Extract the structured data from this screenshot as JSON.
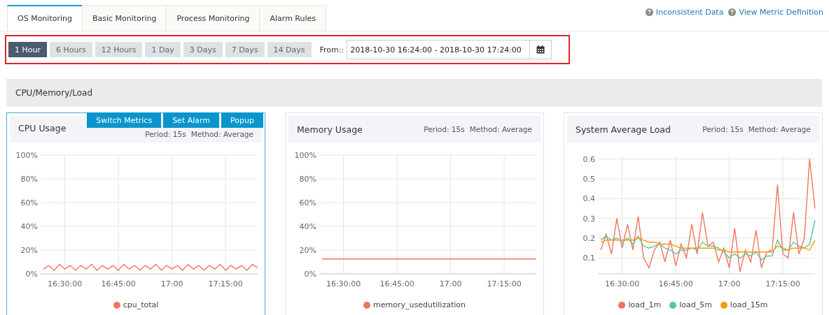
{
  "tabs": [
    {
      "label": "OS Monitoring",
      "selected": true
    },
    {
      "label": "Basic Monitoring",
      "selected": false
    },
    {
      "label": "Process Monitoring",
      "selected": false
    },
    {
      "label": "Alarm Rules",
      "selected": false
    }
  ],
  "help_links": [
    {
      "label": "Inconsistent Data"
    },
    {
      "label": "View Metric Definition"
    }
  ],
  "time_ranges": [
    {
      "label": "1 Hour",
      "selected": true
    },
    {
      "label": "6 Hours",
      "selected": false
    },
    {
      "label": "12 Hours",
      "selected": false
    },
    {
      "label": "1 Day",
      "selected": false
    },
    {
      "label": "3 Days",
      "selected": false
    },
    {
      "label": "7 Days",
      "selected": false
    },
    {
      "label": "14 Days",
      "selected": false
    }
  ],
  "date_range": {
    "label": "From::",
    "value": "2018-10-30 16:24:00 - 2018-10-30 17:24:00"
  },
  "section": {
    "title": "CPU/Memory/Load"
  },
  "cards": [
    {
      "title": "CPU Usage",
      "period": "Period: 15s",
      "method": "Method: Average",
      "selected": true,
      "actions": [
        "Switch Metrics",
        "Set Alarm",
        "Popup"
      ],
      "chart_data": {
        "type": "line",
        "grid": true,
        "legend": "bottom",
        "categories": [
          null,
          null,
          null,
          null,
          "16:30:00",
          null,
          null,
          null,
          null,
          null,
          null,
          null,
          null,
          null,
          "16:45:00",
          null,
          null,
          null,
          null,
          null,
          null,
          null,
          null,
          null,
          "17:00",
          null,
          null,
          null,
          null,
          null,
          null,
          null,
          null,
          null,
          "17:15:00",
          null,
          null,
          null,
          null,
          null,
          null
        ],
        "ylim": [
          0,
          100
        ],
        "yticks": [
          {
            "value": 0,
            "label": "0%"
          },
          {
            "value": 20,
            "label": "20%"
          },
          {
            "value": 40,
            "label": "40%"
          },
          {
            "value": 60,
            "label": "60%"
          },
          {
            "value": 80,
            "label": "80%"
          },
          {
            "value": 100,
            "label": "100%"
          }
        ],
        "series": [
          {
            "name": "cpu_total",
            "color": "#f4735f",
            "values": [
              4,
              7,
              3,
              8,
              4,
              7,
              3,
              7,
              4,
              8,
              3,
              7,
              4,
              7,
              3,
              8,
              4,
              7,
              3,
              7,
              4,
              8,
              3,
              7,
              4,
              7,
              3,
              8,
              4,
              7,
              3,
              7,
              4,
              8,
              3,
              7,
              4,
              7,
              3,
              8,
              5
            ]
          }
        ]
      }
    },
    {
      "title": "Memory Usage",
      "period": "Period: 15s",
      "method": "Method: Average",
      "selected": false,
      "chart_data": {
        "type": "line",
        "grid": true,
        "legend": "bottom",
        "categories": [
          null,
          null,
          null,
          null,
          "16:30:00",
          null,
          null,
          null,
          null,
          null,
          null,
          null,
          null,
          null,
          "16:45:00",
          null,
          null,
          null,
          null,
          null,
          null,
          null,
          null,
          null,
          "17:00",
          null,
          null,
          null,
          null,
          null,
          null,
          null,
          null,
          null,
          "17:15:00",
          null,
          null,
          null,
          null,
          null,
          null
        ],
        "ylim": [
          0,
          100
        ],
        "yticks": [
          {
            "value": 0,
            "label": "0%"
          },
          {
            "value": 20,
            "label": "20%"
          },
          {
            "value": 40,
            "label": "40%"
          },
          {
            "value": 60,
            "label": "60%"
          },
          {
            "value": 80,
            "label": "80%"
          },
          {
            "value": 100,
            "label": "100%"
          }
        ],
        "series": [
          {
            "name": "memory_usedutilization",
            "color": "#f4735f",
            "values": [
              12.5,
              12.5,
              12.5,
              12.5,
              12.5,
              12.5,
              12.5,
              12.5,
              12.5,
              12.5,
              12.5,
              12.5,
              12.5,
              12.5,
              12.5,
              12.5,
              12.5,
              12.5,
              12.5,
              12.5,
              12.5,
              12.5,
              12.5,
              12.5,
              12.5,
              12.5,
              12.5,
              12.5,
              12.5,
              12.5,
              12.5,
              12.5,
              12.5,
              12.5,
              12.5,
              12.5,
              12.5,
              12.5,
              12.5,
              12.5,
              12.5
            ]
          }
        ]
      }
    },
    {
      "title": "System Average Load",
      "period": "Period: 15s",
      "method": "Method: Average",
      "selected": false,
      "chart_data": {
        "type": "line",
        "grid": true,
        "legend": "bottom",
        "categories": [
          null,
          null,
          null,
          null,
          "16:30:00",
          null,
          null,
          null,
          null,
          null,
          null,
          null,
          null,
          null,
          "16:45:00",
          null,
          null,
          null,
          null,
          null,
          null,
          null,
          null,
          null,
          "17:00",
          null,
          null,
          null,
          null,
          null,
          null,
          null,
          null,
          null,
          "17:15:00",
          null,
          null,
          null,
          null,
          null,
          null
        ],
        "ylim": [
          0.02,
          0.62
        ],
        "yticks": [
          0.1,
          0.2,
          0.3,
          0.4,
          0.5,
          0.6
        ],
        "series": [
          {
            "name": "load_1m",
            "color": "#f4735f",
            "values": [
              0.14,
              0.22,
              0.12,
              0.3,
              0.15,
              0.27,
              0.14,
              0.31,
              0.1,
              0.05,
              0.14,
              0.18,
              0.08,
              0.19,
              0.06,
              0.17,
              0.1,
              0.27,
              0.12,
              0.33,
              0.16,
              0.18,
              0.08,
              0.15,
              0.05,
              0.25,
              0.03,
              0.14,
              0.08,
              0.24,
              0.05,
              0.13,
              0.14,
              0.47,
              0.12,
              0.1,
              0.33,
              0.12,
              0.2,
              0.6,
              0.35
            ]
          },
          {
            "name": "load_5m",
            "color": "#5bc49f",
            "values": [
              0.19,
              0.21,
              0.19,
              0.2,
              0.18,
              0.2,
              0.17,
              0.21,
              0.16,
              0.15,
              0.16,
              0.17,
              0.15,
              0.14,
              0.12,
              0.14,
              0.14,
              0.15,
              0.14,
              0.18,
              0.16,
              0.16,
              0.15,
              0.13,
              0.1,
              0.12,
              0.1,
              0.12,
              0.11,
              0.13,
              0.09,
              0.11,
              0.11,
              0.19,
              0.14,
              0.14,
              0.18,
              0.16,
              0.15,
              0.17,
              0.29
            ]
          },
          {
            "name": "load_15m",
            "color": "#fa9a0f",
            "values": [
              0.18,
              0.19,
              0.19,
              0.19,
              0.19,
              0.19,
              0.19,
              0.2,
              0.19,
              0.18,
              0.18,
              0.17,
              0.17,
              0.17,
              0.16,
              0.15,
              0.15,
              0.15,
              0.15,
              0.15,
              0.15,
              0.15,
              0.14,
              0.14,
              0.13,
              0.13,
              0.13,
              0.13,
              0.13,
              0.13,
              0.13,
              0.13,
              0.13,
              0.16,
              0.15,
              0.14,
              0.15,
              0.15,
              0.15,
              0.14,
              0.19
            ]
          }
        ]
      }
    }
  ]
}
